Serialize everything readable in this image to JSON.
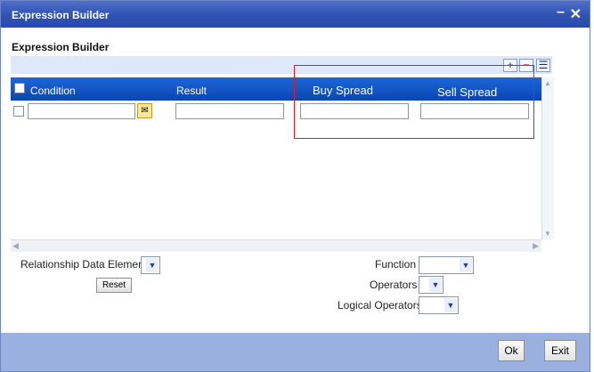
{
  "window": {
    "title": "Expression Builder",
    "minimize_glyph": "–",
    "close_glyph": "✕"
  },
  "section": {
    "title": "Expression Builder"
  },
  "grid_toolbar": {
    "add_glyph": "+",
    "delete_glyph": "−",
    "view_glyph": "☰"
  },
  "grid": {
    "columns": [
      "Condition",
      "Result",
      "Buy Spread",
      "Sell Spread"
    ],
    "rows": [
      {
        "condition": "",
        "result": "",
        "buy_spread": "",
        "sell_spread": ""
      }
    ],
    "lookup_glyph": "✉"
  },
  "form": {
    "relationship_data_element_label": "Relationship Data Element",
    "relationship_data_element_value": "",
    "reset_label": "Reset",
    "function_label": "Function",
    "function_value": "",
    "operators_label": "Operators",
    "operators_value": "",
    "logical_operators_label": "Logical Operators",
    "logical_operators_value": ""
  },
  "footer": {
    "ok_label": "Ok",
    "exit_label": "Exit"
  },
  "colors": {
    "titlebar": "#2f52b3",
    "grid_header": "#0b45b4",
    "footer": "#9ab0de",
    "highlight": "#e02020"
  }
}
